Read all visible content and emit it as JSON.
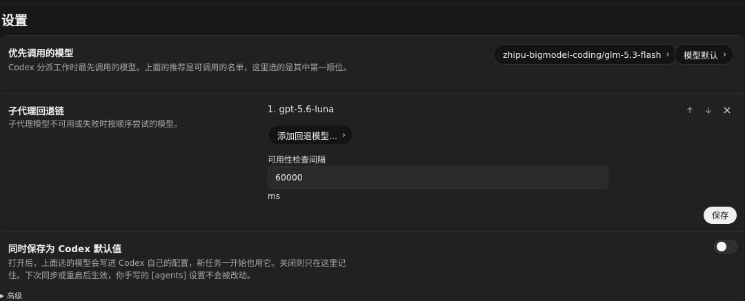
{
  "page": {
    "title": "设置"
  },
  "preferred_model": {
    "title": "优先调用的模型",
    "description": "Codex 分派工作时最先调用的模型。上面的推荐是可调用的名单，这里选的是其中第一顺位。",
    "model_label": "zhipu-bigmodel-coding/glm-5.3-flash",
    "default_label": "模型默认",
    "chevron_icon": "chevron-right-icon"
  },
  "fallback_chain": {
    "title": "子代理回退链",
    "description": "子代理模型不可用或失败时按顺序尝试的模型。",
    "items": [
      {
        "label": "1. gpt-5.6-luna"
      }
    ],
    "add_label": "添加回退模型...",
    "interval_label": "可用性检查间隔",
    "interval_value": "60000",
    "interval_unit": "ms",
    "save_label": "保存",
    "icons": {
      "up": "arrow-up-icon",
      "down": "arrow-down-icon",
      "remove": "close-icon"
    }
  },
  "save_as_default": {
    "title": "同时保存为 Codex 默认值",
    "description": "打开后，上面选的模型会写进 Codex 自己的配置，新任务一开始也用它。关闭则只在这里记住。下次同步或重启后生效，你手写的 [agents] 设置不会被改动。",
    "enabled": false
  },
  "advanced": {
    "label": "高级",
    "icon": "triangle-right-icon"
  }
}
